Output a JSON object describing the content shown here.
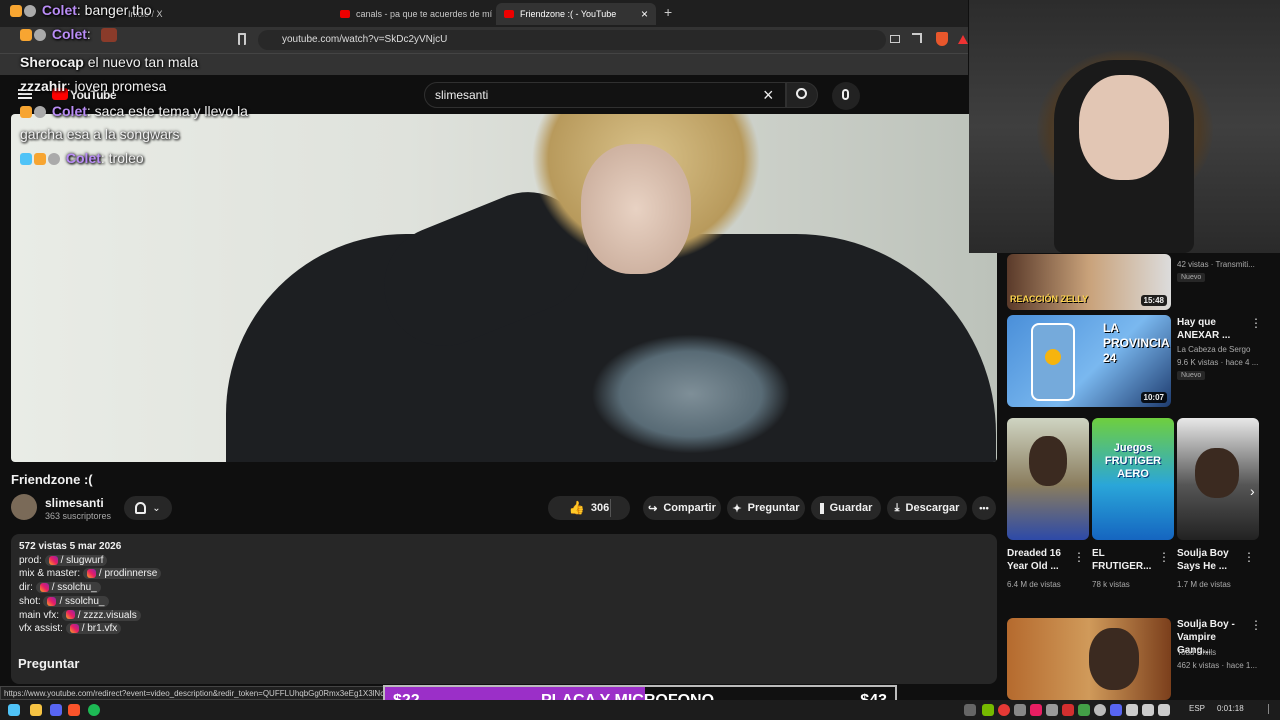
{
  "browser": {
    "tabs": [
      {
        "label": "Inicio / X"
      },
      {
        "label": "canals - pa que te acuerdes de mí [E"
      },
      {
        "label": "Friendzone :( - YouTube"
      }
    ],
    "new_tab": "+",
    "close_tab": "×",
    "url": "youtube.com/watch?v=SkDc2yVNjcU",
    "status_url": "https://www.youtube.com/redirect?event=video_description&redir_token=QUFFLUhqbGg0Rmx3eEg1X3lNcj..."
  },
  "youtube": {
    "logo_text": "YouTube",
    "search_value": "slimesanti"
  },
  "video": {
    "title": "Friendzone :(",
    "channel": "slimesanti",
    "subscribers": "363 suscriptores",
    "likes": "306",
    "share_label": "Compartir",
    "ask_label": "Preguntar",
    "save_label": "Guardar",
    "download_label": "Descargar",
    "more_label": "•••"
  },
  "description": {
    "stats": "572 vistas  5 mar 2026",
    "lines": [
      {
        "role": "prod:",
        "handle": "/ slugwurf"
      },
      {
        "role": "mix & master:",
        "handle": "/ prodinnerse"
      },
      {
        "role": "dir:",
        "handle": "/ ssolchu_"
      },
      {
        "role": "shot:",
        "handle": "/ ssolchu_"
      },
      {
        "role": "main vfx:",
        "handle": "/ zzzz.visuals"
      },
      {
        "role": "vfx assist:",
        "handle": "/ br1.vfx"
      }
    ],
    "section_title": "Preguntar"
  },
  "chat": [
    {
      "user": "Colet",
      "message": ": banger tho",
      "color": "#b98cf5"
    },
    {
      "user": "Colet",
      "message": ":",
      "color": "#b98cf5"
    },
    {
      "user": "Sherocap",
      "message": " el nuevo tan mala",
      "color": "#ffffff"
    },
    {
      "user": "zzzahir",
      "message": ": joven promesa",
      "color": "#ffffff"
    },
    {
      "user": "Colet",
      "message": ": saca este tema y llevo la",
      "color": "#b98cf5"
    },
    {
      "user": "",
      "message": "garcha esa a la songwars",
      "color": "#ffffff"
    },
    {
      "user": "Colet",
      "message": ": troleo",
      "color": "#b98cf5"
    }
  ],
  "sidebar": {
    "top_meta": "42 vistas · Transmiti...",
    "top_badge": "Nuevo",
    "top_thumb_text": "REACCIÓN ZELLY",
    "top_duration": "15:48",
    "items": [
      {
        "title": "Hay que ANEXAR ...",
        "channel": "La Cabeza de Sergo",
        "meta": "9.6 K vistas · hace 4 ...",
        "badge": "Nuevo",
        "duration": "10:07",
        "thumb_text": "LA PROVINCIA 24"
      }
    ],
    "shorts": [
      {
        "title": "Dreaded 16 Year Old ...",
        "meta": "6.4 M de vistas"
      },
      {
        "title": "EL FRUTIGER...",
        "meta": "78 k vistas",
        "thumb_text": "Juegos FRUTIGER AERO"
      },
      {
        "title": "Soulja Boy Says He ...",
        "meta": "1.7 M de vistas"
      }
    ],
    "bottom": {
      "title": "Soulja Boy - Vampire Gang...",
      "channel": "Todd Chills",
      "meta": "462 k vistas · hace 1..."
    }
  },
  "donation": {
    "left_amount": "$22",
    "label": "PLACA Y MICROFONO",
    "right_amount": "$43",
    "progress": 0.51,
    "color": "#9b2fc8"
  },
  "taskbar": {
    "lang": "ESP",
    "time": "0:01:18"
  }
}
